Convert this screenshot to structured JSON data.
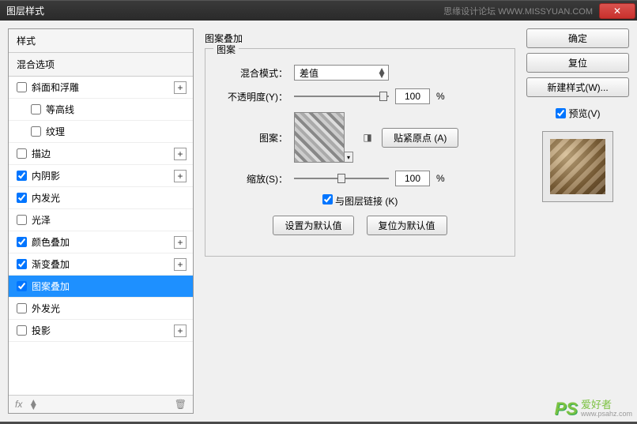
{
  "titlebar": {
    "title": "图层样式",
    "watermark": "思缘设计论坛  WWW.MISSYUAN.COM",
    "close_symbol": "✕"
  },
  "left": {
    "header": "样式",
    "subheader": "混合选项",
    "items": [
      {
        "label": "斜面和浮雕",
        "checked": false,
        "indent": false,
        "plus": true
      },
      {
        "label": "等高线",
        "checked": false,
        "indent": true,
        "plus": false
      },
      {
        "label": "纹理",
        "checked": false,
        "indent": true,
        "plus": false
      },
      {
        "label": "描边",
        "checked": false,
        "indent": false,
        "plus": true
      },
      {
        "label": "内阴影",
        "checked": true,
        "indent": false,
        "plus": true
      },
      {
        "label": "内发光",
        "checked": true,
        "indent": false,
        "plus": false
      },
      {
        "label": "光泽",
        "checked": false,
        "indent": false,
        "plus": false
      },
      {
        "label": "颜色叠加",
        "checked": true,
        "indent": false,
        "plus": true
      },
      {
        "label": "渐变叠加",
        "checked": true,
        "indent": false,
        "plus": true
      },
      {
        "label": "图案叠加",
        "checked": true,
        "indent": false,
        "plus": false,
        "selected": true
      },
      {
        "label": "外发光",
        "checked": false,
        "indent": false,
        "plus": false
      },
      {
        "label": "投影",
        "checked": false,
        "indent": false,
        "plus": true
      }
    ],
    "footer_fx": "fx",
    "footer_up": "▲",
    "footer_down": "▼",
    "footer_trash": "🗑"
  },
  "center": {
    "panel_title": "图案叠加",
    "group_legend": "图案",
    "blend_mode_label": "混合模式：",
    "blend_mode_value": "差值",
    "opacity_label": "不透明度(Y)：",
    "opacity_value": "100",
    "opacity_unit": "%",
    "pattern_label": "图案：",
    "snap_button": "贴紧原点 (A)",
    "scale_label": "缩放(S)：",
    "scale_value": "100",
    "scale_unit": "%",
    "link_label": "与图层链接 (K)",
    "link_checked": true,
    "default_set": "设置为默认值",
    "default_reset": "复位为默认值",
    "new_icon": "◨"
  },
  "right": {
    "ok": "确定",
    "reset": "复位",
    "new_style": "新建样式(W)...",
    "preview_label": "预览(V)",
    "preview_checked": true
  },
  "watermark_corner": {
    "logo": "PS",
    "cn": "爱好者",
    "url": "www.psahz.com"
  }
}
